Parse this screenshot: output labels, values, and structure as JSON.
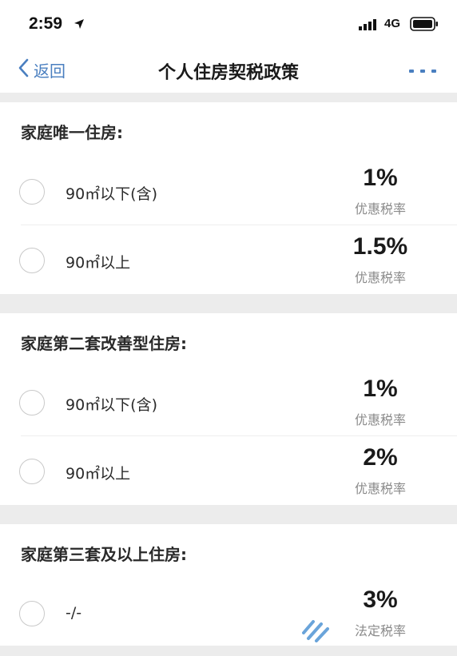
{
  "status_bar": {
    "time": "2:59",
    "network": "4G"
  },
  "nav": {
    "back_label": "返回",
    "title": "个人住房契税政策"
  },
  "sections": [
    {
      "heading": "家庭唯一住房:",
      "rows": [
        {
          "label": "90㎡以下(含)",
          "rate": "1%",
          "rate_label": "优惠税率"
        },
        {
          "label": "90㎡以上",
          "rate": "1.5%",
          "rate_label": "优惠税率"
        }
      ]
    },
    {
      "heading": "家庭第二套改善型住房:",
      "rows": [
        {
          "label": "90㎡以下(含)",
          "rate": "1%",
          "rate_label": "优惠税率"
        },
        {
          "label": "90㎡以上",
          "rate": "2%",
          "rate_label": "优惠税率"
        }
      ]
    },
    {
      "heading": "家庭第三套及以上住房:",
      "rows": [
        {
          "label": "-/-",
          "rate": "3%",
          "rate_label": "法定税率"
        }
      ]
    }
  ],
  "colors": {
    "accent": "#4a7fc0",
    "background": "#ececec",
    "card": "#ffffff"
  },
  "icons": [
    "location-arrow-icon",
    "signal-icon",
    "battery-icon",
    "back-chevron-icon",
    "more-icon",
    "watermark-logo-icon"
  ]
}
